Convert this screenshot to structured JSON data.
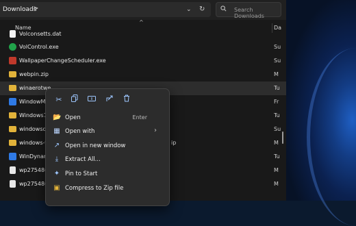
{
  "address": {
    "crumb": "Downloads",
    "crumb_chevron": ">",
    "dropdown": "⌄",
    "refresh": "↻",
    "search_placeholder": "Search Downloads"
  },
  "columns": {
    "name": "Name",
    "date": "Da"
  },
  "files": [
    {
      "name": "Volconsetts.dat",
      "date": "",
      "kind": "dat"
    },
    {
      "name": "VolControl.exe",
      "date": "Su",
      "kind": "exe-green"
    },
    {
      "name": "WallpaperChangeScheduler.exe",
      "date": "Su",
      "kind": "exe-red"
    },
    {
      "name": "webpin.zip",
      "date": "M",
      "kind": "folder"
    },
    {
      "name": "winaerotwe",
      "date": "Tu",
      "kind": "folder"
    },
    {
      "name": "WindowMe",
      "date": "Fr",
      "kind": "exe-blue"
    },
    {
      "name": "Windows7G",
      "date": "Tu",
      "kind": "folder"
    },
    {
      "name": "windowsde",
      "date": "Su",
      "kind": "folder"
    },
    {
      "name": "windows-vi",
      "date": "M",
      "kind": "folder",
      "suffix": "ip"
    },
    {
      "name": "WinDynami",
      "date": "Tu",
      "kind": "exe-blue"
    },
    {
      "name": "wp2754860-",
      "date": "M",
      "kind": "file"
    },
    {
      "name": "wp2754860-",
      "date": "M",
      "kind": "file"
    }
  ],
  "context_menu": {
    "quick_actions": [
      "cut-icon",
      "copy-icon",
      "rename-icon",
      "share-icon",
      "delete-icon"
    ],
    "items": [
      {
        "label": "Open",
        "shortcut": "Enter",
        "icon": "folder-open-icon"
      },
      {
        "label": "Open with",
        "shortcut": "",
        "icon": "open-with-icon"
      },
      {
        "label": "Open in new window",
        "shortcut": "",
        "icon": "new-window-icon"
      },
      {
        "label": "Extract All...",
        "shortcut": "",
        "icon": "extract-icon"
      },
      {
        "label": "Pin to Start",
        "shortcut": "",
        "icon": "pin-icon"
      },
      {
        "label": "Compress to Zip file",
        "shortcut": "",
        "icon": "zip-icon"
      }
    ]
  }
}
